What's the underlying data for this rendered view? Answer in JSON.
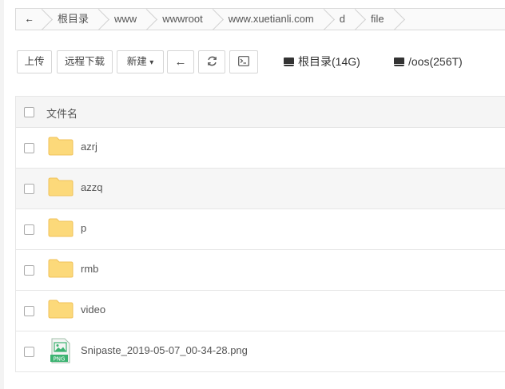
{
  "breadcrumb": [
    "根目录",
    "www",
    "wwwroot",
    "www.xuetianli.com",
    "d",
    "file"
  ],
  "toolbar": {
    "upload": "上传",
    "remote_download": "远程下载",
    "new": "新建",
    "new_caret": "▾",
    "back_icon": "back-arrow-icon",
    "refresh_icon": "refresh-icon",
    "terminal_icon": "terminal-icon"
  },
  "disks": [
    {
      "label": "根目录(14G)",
      "icon": "hard-disk-icon"
    },
    {
      "label": "/oos(256T)",
      "icon": "hard-disk-icon"
    }
  ],
  "table": {
    "header": "文件名",
    "rows": [
      {
        "name": "azrj",
        "type": "folder"
      },
      {
        "name": "azzq",
        "type": "folder"
      },
      {
        "name": "p",
        "type": "folder"
      },
      {
        "name": "rmb",
        "type": "folder"
      },
      {
        "name": "video",
        "type": "folder"
      },
      {
        "name": "Snipaste_2019-05-07_00-34-28.png",
        "type": "png",
        "badge": "PNG"
      }
    ]
  },
  "colors": {
    "folder": "#fcd97a",
    "folder_edge": "#f0c25a",
    "png_green": "#3cb371"
  }
}
